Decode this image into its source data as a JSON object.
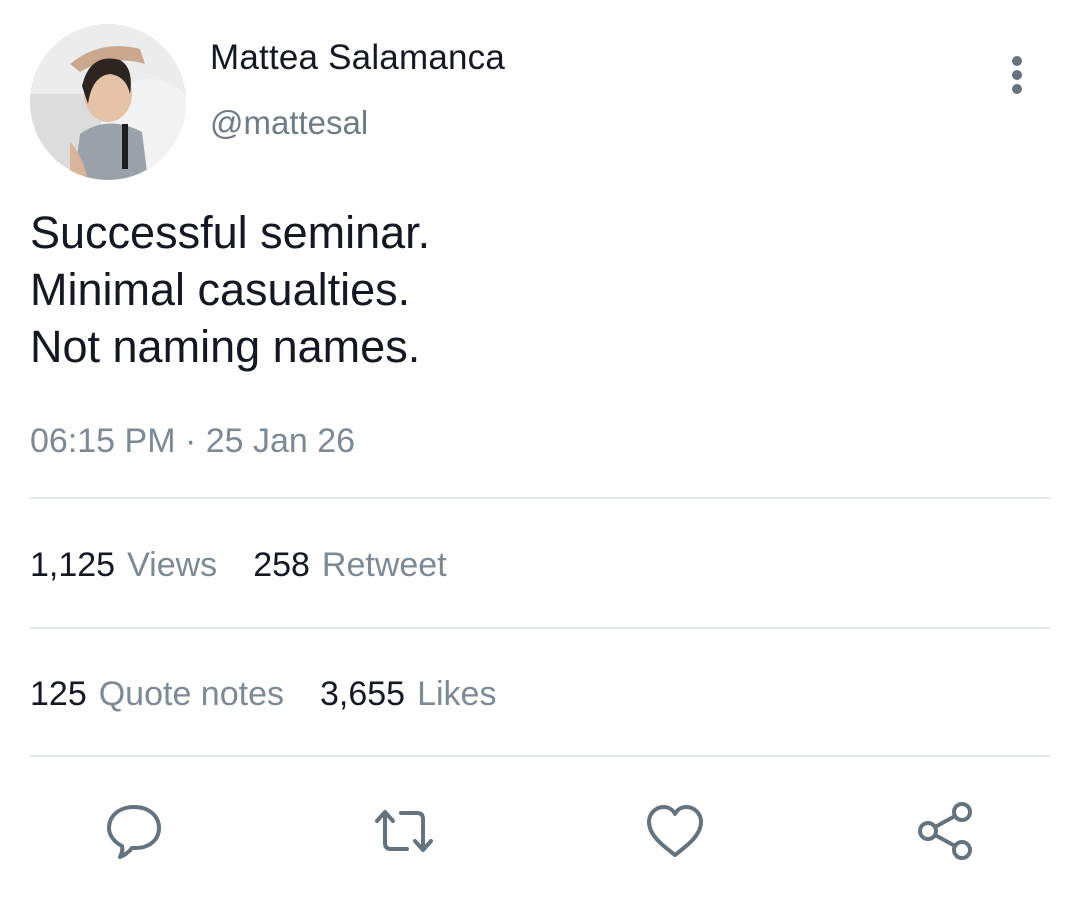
{
  "user": {
    "display_name": "Mattea Salamanca",
    "handle": "@mattesal"
  },
  "tweet": {
    "lines": [
      "Successful seminar.",
      "Minimal casualties.",
      "Not naming names."
    ],
    "timestamp": "06:15 PM · 25 Jan 26"
  },
  "stats": {
    "views": {
      "count": "1,125",
      "label": "Views"
    },
    "retweets": {
      "count": "258",
      "label": "Retweet"
    },
    "quotes": {
      "count": "125",
      "label": "Quote notes"
    },
    "likes": {
      "count": "3,655",
      "label": "Likes"
    }
  },
  "icons": {
    "more": "more-vertical-icon",
    "reply": "reply-bubble-icon",
    "retweet": "retweet-icon",
    "like": "heart-icon",
    "share": "share-icon"
  },
  "colors": {
    "text_primary": "#141823",
    "text_secondary": "#7c8a96",
    "icon": "#65737e",
    "divider": "#e4e9ed"
  }
}
